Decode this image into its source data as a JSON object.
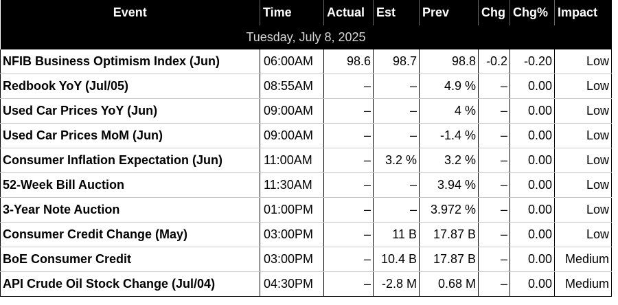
{
  "header": {
    "event": "Event",
    "time": "Time",
    "actual": "Actual",
    "est": "Est",
    "prev": "Prev",
    "chg": "Chg",
    "chg_pct": "Chg%",
    "impact": "Impact"
  },
  "date_label": "Tuesday, July 8, 2025",
  "rows": [
    {
      "event": "NFIB Business Optimism Index (Jun)",
      "time": "06:00AM",
      "actual": "98.6",
      "est": "98.7",
      "prev": "98.8",
      "chg": "-0.2",
      "chg_pct": "-0.20",
      "impact": "Low"
    },
    {
      "event": "Redbook YoY (Jul/05)",
      "time": "08:55AM",
      "actual": "–",
      "est": "–",
      "prev": "4.9 %",
      "chg": "–",
      "chg_pct": "0.00",
      "impact": "Low"
    },
    {
      "event": "Used Car Prices YoY (Jun)",
      "time": "09:00AM",
      "actual": "–",
      "est": "–",
      "prev": "4 %",
      "chg": "–",
      "chg_pct": "0.00",
      "impact": "Low"
    },
    {
      "event": "Used Car Prices MoM (Jun)",
      "time": "09:00AM",
      "actual": "–",
      "est": "–",
      "prev": "-1.4 %",
      "chg": "–",
      "chg_pct": "0.00",
      "impact": "Low"
    },
    {
      "event": "Consumer Inflation Expectation (Jun)",
      "time": "11:00AM",
      "actual": "–",
      "est": "3.2 %",
      "prev": "3.2 %",
      "chg": "–",
      "chg_pct": "0.00",
      "impact": "Low"
    },
    {
      "event": "52-Week Bill Auction",
      "time": "11:30AM",
      "actual": "–",
      "est": "–",
      "prev": "3.94 %",
      "chg": "–",
      "chg_pct": "0.00",
      "impact": "Low"
    },
    {
      "event": "3-Year Note Auction",
      "time": "01:00PM",
      "actual": "–",
      "est": "–",
      "prev": "3.972 %",
      "chg": "–",
      "chg_pct": "0.00",
      "impact": "Low"
    },
    {
      "event": "Consumer Credit Change (May)",
      "time": "03:00PM",
      "actual": "–",
      "est": "11 B",
      "prev": "17.87 B",
      "chg": "–",
      "chg_pct": "0.00",
      "impact": "Low"
    },
    {
      "event": "BoE Consumer Credit",
      "time": "03:00PM",
      "actual": "–",
      "est": "10.4 B",
      "prev": "17.87 B",
      "chg": "–",
      "chg_pct": "0.00",
      "impact": "Medium"
    },
    {
      "event": "API Crude Oil Stock Change (Jul/04)",
      "time": "04:30PM",
      "actual": "–",
      "est": "-2.8 M",
      "prev": "0.68 M",
      "chg": "–",
      "chg_pct": "0.00",
      "impact": "Medium"
    }
  ]
}
